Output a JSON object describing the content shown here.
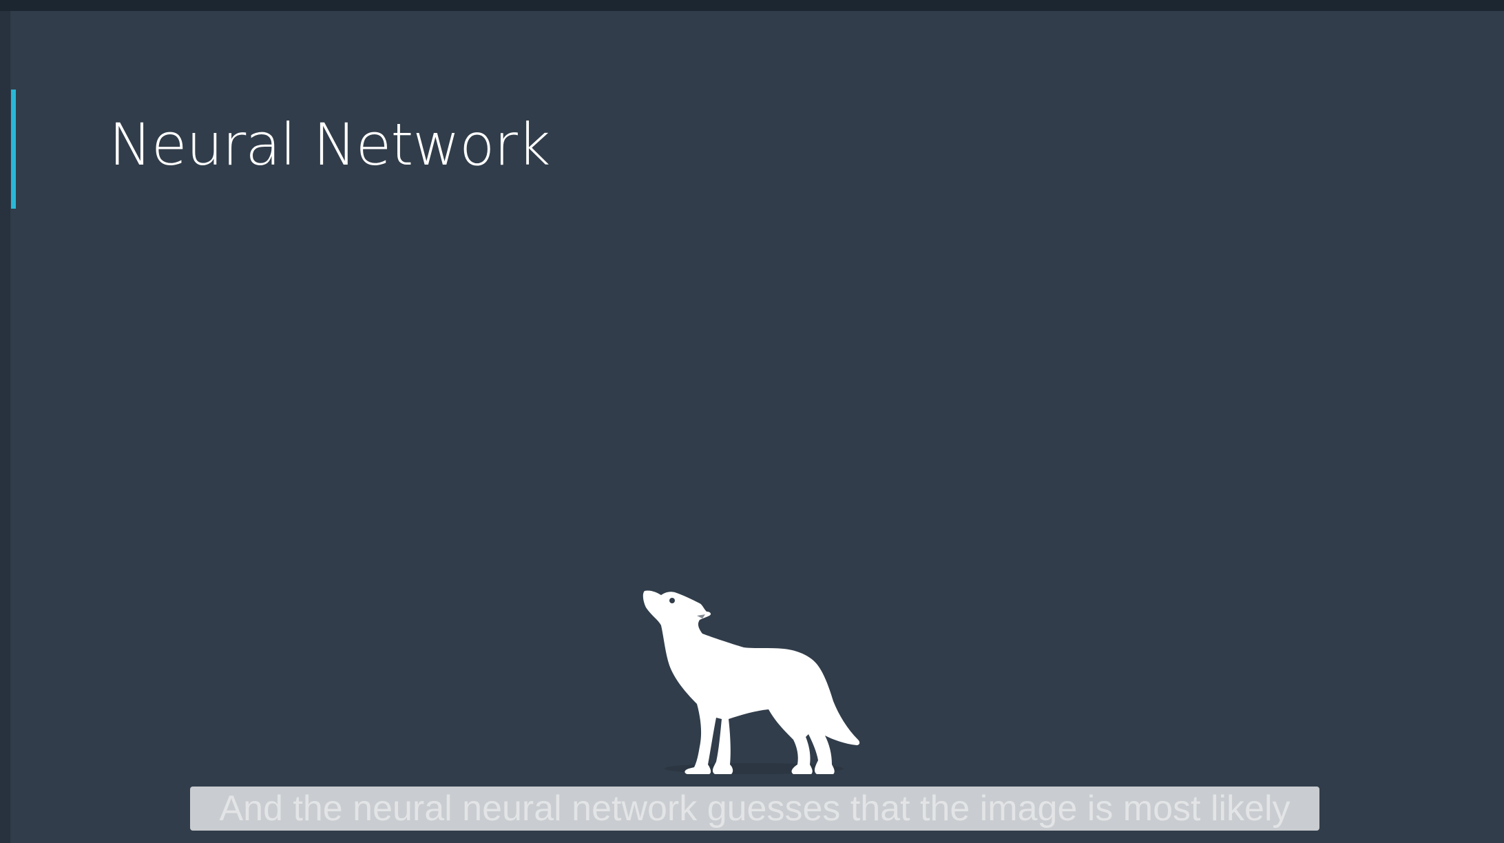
{
  "slide": {
    "title": "Neural Network",
    "accent_color": "#29b8d6",
    "background_color": "#313d4a"
  },
  "illustration": {
    "icon": "howling-wolf-icon",
    "color": "#ffffff"
  },
  "caption": {
    "text": "And the neural neural network guesses that the image is most likely"
  }
}
